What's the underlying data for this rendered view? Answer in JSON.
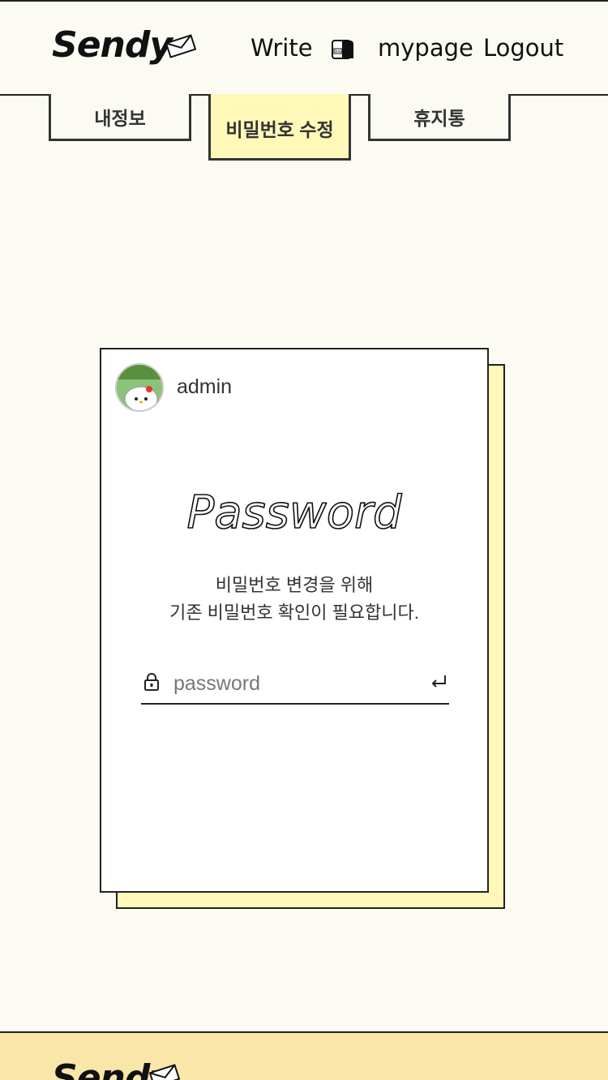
{
  "header": {
    "logo": "Sendy",
    "nav": {
      "write": "Write",
      "mailbox_icon": "mailbox-icon",
      "mypage": "mypage",
      "logout": "Logout"
    }
  },
  "tabs": [
    {
      "label": "내정보",
      "active": false
    },
    {
      "label": "비밀번호 수정",
      "active": true
    },
    {
      "label": "휴지통",
      "active": false
    }
  ],
  "card": {
    "username": "admin",
    "title": "Password",
    "description_line1": "비밀번호 변경을 위해",
    "description_line2": "기존 비밀번호 확인이 필요합니다.",
    "password_placeholder": "password",
    "password_value": ""
  },
  "footer": {
    "logo": "Sendy"
  },
  "colors": {
    "background": "#fbfaf3",
    "accent_yellow": "#fff8b8",
    "footer_bg": "#f9e6a8",
    "border": "#222222"
  }
}
